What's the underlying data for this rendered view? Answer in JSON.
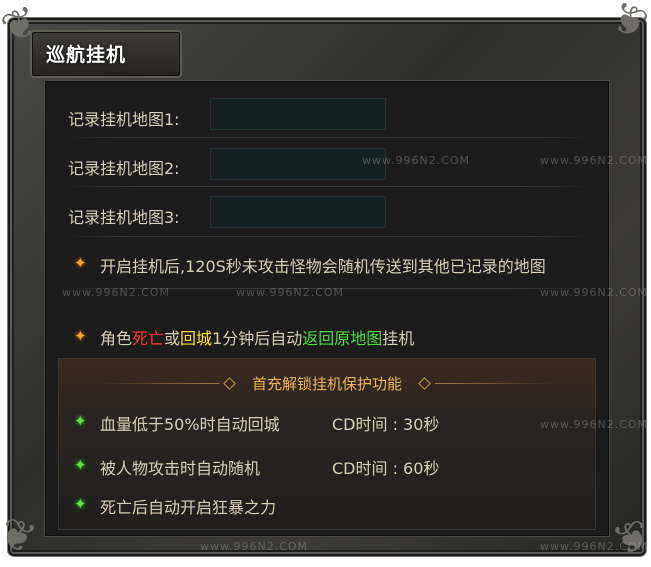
{
  "panel": {
    "title": "巡航挂机"
  },
  "maps": [
    {
      "label": "记录挂机地图1:",
      "value": ""
    },
    {
      "label": "记录挂机地图2:",
      "value": ""
    },
    {
      "label": "记录挂机地图3:",
      "value": ""
    }
  ],
  "info": {
    "line1": "开启挂机后,120S秒未攻击怪物会随机传送到其他已记录的地图",
    "line2_a": "角色",
    "line2_death": "死亡",
    "line2_or": "或",
    "line2_return": "回城",
    "line2_b": "1分钟后自动",
    "line2_back": "返回原地图",
    "line2_c": "挂机"
  },
  "bonus": {
    "title": "首充解锁挂机保护功能",
    "perks": [
      {
        "text": "血量低于50%时自动回城",
        "cd": "CD时间 : 30秒"
      },
      {
        "text": "被人物攻击时自动随机",
        "cd": "CD时间 : 60秒"
      },
      {
        "text": "死亡后自动开启狂暴之力",
        "cd": ""
      }
    ]
  },
  "watermark": "www.996N2.COM",
  "colors": {
    "death": "#ff3b2f",
    "return": "#ffe236",
    "back": "#4cdc44",
    "bonus_title": "#f0b45a"
  }
}
